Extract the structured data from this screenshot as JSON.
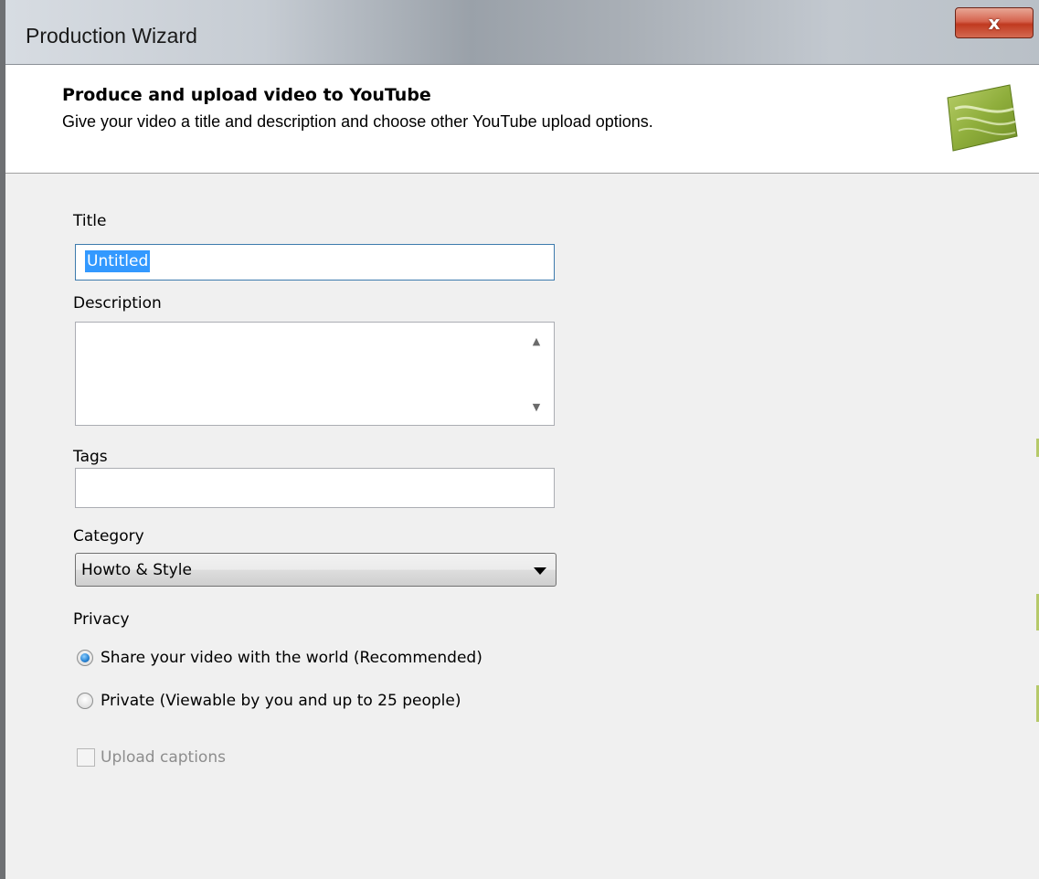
{
  "window": {
    "title": "Production Wizard",
    "close_label": "x"
  },
  "header": {
    "heading": "Produce and upload video to YouTube",
    "subtext": "Give your video a title and description and choose other YouTube upload options.",
    "logo_icon": "production-wizard-logo-icon"
  },
  "form": {
    "title_label": "Title",
    "title_value": "Untitled",
    "description_label": "Description",
    "description_value": "",
    "tags_label": "Tags",
    "tags_value": "",
    "category_label": "Category",
    "category_value": "Howto & Style",
    "privacy_label": "Privacy",
    "privacy_options": [
      {
        "label": "Share your video with the world (Recommended)",
        "checked": true
      },
      {
        "label": "Private (Viewable by you and up to 25 people)",
        "checked": false
      }
    ],
    "upload_captions_label": "Upload captions",
    "upload_captions_checked": false,
    "upload_captions_enabled": false
  },
  "colors": {
    "selection": "#3399ff",
    "close_button": "#c0391f",
    "logo_green": "#8fae3c"
  }
}
